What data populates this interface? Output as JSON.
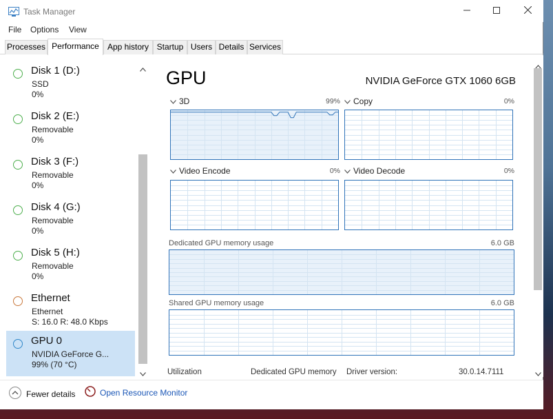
{
  "window": {
    "title": "Task Manager"
  },
  "menu": [
    "File",
    "Options",
    "View"
  ],
  "tabs": [
    {
      "label": "Processes",
      "active": false
    },
    {
      "label": "Performance",
      "active": true
    },
    {
      "label": "App history",
      "active": false
    },
    {
      "label": "Startup",
      "active": false
    },
    {
      "label": "Users",
      "active": false
    },
    {
      "label": "Details",
      "active": false
    },
    {
      "label": "Services",
      "active": false
    }
  ],
  "sidebar": {
    "items": [
      {
        "name": "Disk 1 (D:)",
        "line1": "SSD",
        "line2": "0%",
        "color": "#4cae4c"
      },
      {
        "name": "Disk 2 (E:)",
        "line1": "Removable",
        "line2": "0%",
        "color": "#4cae4c"
      },
      {
        "name": "Disk 3 (F:)",
        "line1": "Removable",
        "line2": "0%",
        "color": "#4cae4c"
      },
      {
        "name": "Disk 4 (G:)",
        "line1": "Removable",
        "line2": "0%",
        "color": "#4cae4c"
      },
      {
        "name": "Disk 5 (H:)",
        "line1": "Removable",
        "line2": "0%",
        "color": "#4cae4c"
      },
      {
        "name": "Ethernet",
        "line1": "Ethernet",
        "line2": "S: 16.0  R: 48.0 Kbps",
        "color": "#c8773a"
      },
      {
        "name": "GPU 0",
        "line1": "NVIDIA GeForce G...",
        "line2": "99%  (70 °C)",
        "color": "#2e86c8",
        "selected": true
      }
    ]
  },
  "gpu": {
    "title": "GPU",
    "model": "NVIDIA GeForce GTX 1060 6GB",
    "engines": [
      {
        "label": "3D",
        "percent": "99%",
        "utilization": 0.99
      },
      {
        "label": "Copy",
        "percent": "0%",
        "utilization": 0
      },
      {
        "label": "Video Encode",
        "percent": "0%",
        "utilization": 0
      },
      {
        "label": "Video Decode",
        "percent": "0%",
        "utilization": 0
      }
    ],
    "dedicated_memory": {
      "label": "Dedicated GPU memory usage",
      "max": "6.0 GB"
    },
    "shared_memory": {
      "label": "Shared GPU memory usage",
      "max": "6.0 GB"
    },
    "stats": {
      "utilization_label": "Utilization",
      "dedicated_label": "Dedicated GPU memory",
      "driver_label": "Driver version:",
      "driver_value": "30.0.14.7111"
    }
  },
  "footer": {
    "fewer_details": "Fewer details",
    "open_monitor": "Open Resource Monitor"
  },
  "colors": {
    "graph_border": "#2e72b8",
    "graph_fill": "#e8f1fa",
    "grid": "#d4e4f2",
    "selected": "#cce2f6",
    "link": "#1a56b6"
  }
}
